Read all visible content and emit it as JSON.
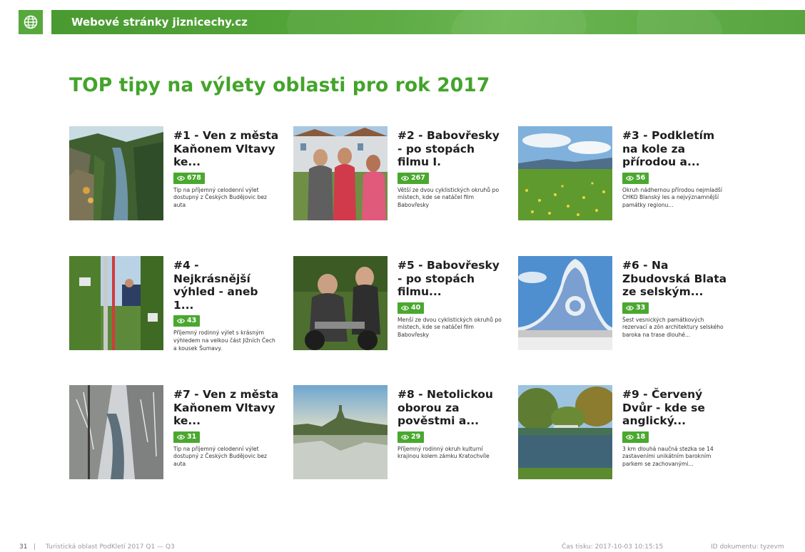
{
  "header": {
    "title": "Webové stránky jiznicechy.cz",
    "icon": "globe-icon",
    "colors": {
      "bar": "#55a73a",
      "icon_box": "#57a83d"
    }
  },
  "heading": "TOP tipy na výlety oblasti pro rok 2017",
  "accent_color": "#43a42b",
  "cards": [
    {
      "title": "#1 - Ven z města Kaňonem Vltavy ke...",
      "views": "678",
      "description": "Tip na příjemný celodenní výlet dostupný z Českých Budějovic bez auta",
      "image": "river-canyon-photo"
    },
    {
      "title": "#2 - Babovřesky - po stopách filmu I.",
      "views": "267",
      "description": "Větší ze dvou cyklistických okruhů po místech, kde se natáčel film Babovřesky",
      "image": "village-women-photo"
    },
    {
      "title": "#3 - Podkletím na kole za přírodou a...",
      "views": "56",
      "description": "Okruh nádhernou přírodou nejmladší CHKO Blanský les a nejvýznamnější památky regionu...",
      "image": "meadow-flowers-photo"
    },
    {
      "title": "#4 - Nejkrásnější výhled - aneb 1...",
      "views": "43",
      "description": "Příjemný rodinný výlet s krásným výhledem na velkou část Jižních Čech a kousek Šumavy.",
      "image": "chairlift-photo"
    },
    {
      "title": "#5 - Babovřesky - po stopách filmu...",
      "views": "40",
      "description": "Menší ze dvou cyklistických okruhů po místech, kde se natáčel film Babovřesky",
      "image": "moped-women-photo"
    },
    {
      "title": "#6 - Na Zbudovská Blata ze selským...",
      "views": "33",
      "description": "Šest vesnických památkových rezervací a zón architektury selského baroka na trase dlouhé...",
      "image": "baroque-gable-photo"
    },
    {
      "title": "#7 - Ven z města Kaňonem Vltavy ke...",
      "views": "31",
      "description": "Tip na příjemný celodenní výlet dostupný z Českých Budějovic bez auta",
      "image": "winter-canyon-photo"
    },
    {
      "title": "#8 - Netolickou oborou za pověstmi a...",
      "views": "29",
      "description": "Příjemný rodinný okruh kulturní krajinou kolem zámku Kratochvíle",
      "image": "lake-village-photo"
    },
    {
      "title": "#9 - Červený Dvůr - kde se anglický...",
      "views": "18",
      "description": "3 km dlouhá naučná stezka se 14 zastaveními unikátním barokním parkem se zachovanými...",
      "image": "park-pond-photo"
    }
  ],
  "footer": {
    "page": "31",
    "separator": "|",
    "document": "Turistická oblast PodKletí 2017 Q1 — Q3",
    "print_time": "Čas tisku: 2017-10-03 10:15:15",
    "document_id": "ID dokumentu: tyzevm"
  }
}
